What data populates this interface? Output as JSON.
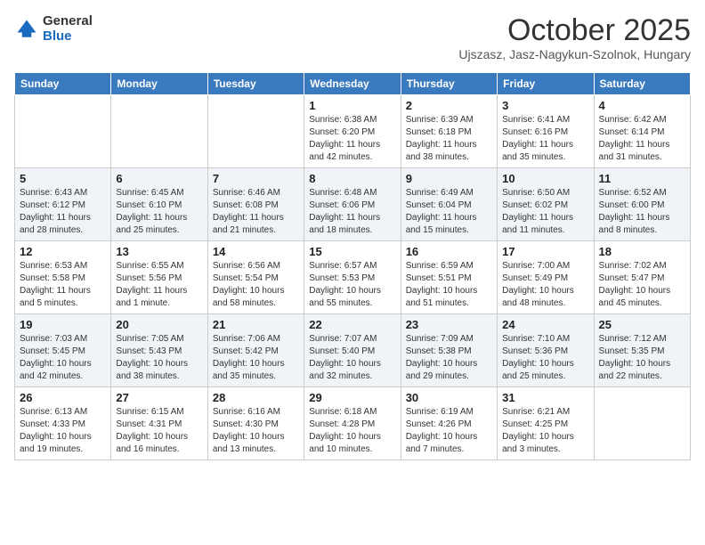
{
  "logo": {
    "general": "General",
    "blue": "Blue"
  },
  "header": {
    "title": "October 2025",
    "subtitle": "Ujszasz, Jasz-Nagykun-Szolnok, Hungary"
  },
  "weekdays": [
    "Sunday",
    "Monday",
    "Tuesday",
    "Wednesday",
    "Thursday",
    "Friday",
    "Saturday"
  ],
  "weeks": [
    [
      {
        "day": "",
        "sunrise": "",
        "sunset": "",
        "daylight": ""
      },
      {
        "day": "",
        "sunrise": "",
        "sunset": "",
        "daylight": ""
      },
      {
        "day": "",
        "sunrise": "",
        "sunset": "",
        "daylight": ""
      },
      {
        "day": "1",
        "sunrise": "Sunrise: 6:38 AM",
        "sunset": "Sunset: 6:20 PM",
        "daylight": "Daylight: 11 hours and 42 minutes."
      },
      {
        "day": "2",
        "sunrise": "Sunrise: 6:39 AM",
        "sunset": "Sunset: 6:18 PM",
        "daylight": "Daylight: 11 hours and 38 minutes."
      },
      {
        "day": "3",
        "sunrise": "Sunrise: 6:41 AM",
        "sunset": "Sunset: 6:16 PM",
        "daylight": "Daylight: 11 hours and 35 minutes."
      },
      {
        "day": "4",
        "sunrise": "Sunrise: 6:42 AM",
        "sunset": "Sunset: 6:14 PM",
        "daylight": "Daylight: 11 hours and 31 minutes."
      }
    ],
    [
      {
        "day": "5",
        "sunrise": "Sunrise: 6:43 AM",
        "sunset": "Sunset: 6:12 PM",
        "daylight": "Daylight: 11 hours and 28 minutes."
      },
      {
        "day": "6",
        "sunrise": "Sunrise: 6:45 AM",
        "sunset": "Sunset: 6:10 PM",
        "daylight": "Daylight: 11 hours and 25 minutes."
      },
      {
        "day": "7",
        "sunrise": "Sunrise: 6:46 AM",
        "sunset": "Sunset: 6:08 PM",
        "daylight": "Daylight: 11 hours and 21 minutes."
      },
      {
        "day": "8",
        "sunrise": "Sunrise: 6:48 AM",
        "sunset": "Sunset: 6:06 PM",
        "daylight": "Daylight: 11 hours and 18 minutes."
      },
      {
        "day": "9",
        "sunrise": "Sunrise: 6:49 AM",
        "sunset": "Sunset: 6:04 PM",
        "daylight": "Daylight: 11 hours and 15 minutes."
      },
      {
        "day": "10",
        "sunrise": "Sunrise: 6:50 AM",
        "sunset": "Sunset: 6:02 PM",
        "daylight": "Daylight: 11 hours and 11 minutes."
      },
      {
        "day": "11",
        "sunrise": "Sunrise: 6:52 AM",
        "sunset": "Sunset: 6:00 PM",
        "daylight": "Daylight: 11 hours and 8 minutes."
      }
    ],
    [
      {
        "day": "12",
        "sunrise": "Sunrise: 6:53 AM",
        "sunset": "Sunset: 5:58 PM",
        "daylight": "Daylight: 11 hours and 5 minutes."
      },
      {
        "day": "13",
        "sunrise": "Sunrise: 6:55 AM",
        "sunset": "Sunset: 5:56 PM",
        "daylight": "Daylight: 11 hours and 1 minute."
      },
      {
        "day": "14",
        "sunrise": "Sunrise: 6:56 AM",
        "sunset": "Sunset: 5:54 PM",
        "daylight": "Daylight: 10 hours and 58 minutes."
      },
      {
        "day": "15",
        "sunrise": "Sunrise: 6:57 AM",
        "sunset": "Sunset: 5:53 PM",
        "daylight": "Daylight: 10 hours and 55 minutes."
      },
      {
        "day": "16",
        "sunrise": "Sunrise: 6:59 AM",
        "sunset": "Sunset: 5:51 PM",
        "daylight": "Daylight: 10 hours and 51 minutes."
      },
      {
        "day": "17",
        "sunrise": "Sunrise: 7:00 AM",
        "sunset": "Sunset: 5:49 PM",
        "daylight": "Daylight: 10 hours and 48 minutes."
      },
      {
        "day": "18",
        "sunrise": "Sunrise: 7:02 AM",
        "sunset": "Sunset: 5:47 PM",
        "daylight": "Daylight: 10 hours and 45 minutes."
      }
    ],
    [
      {
        "day": "19",
        "sunrise": "Sunrise: 7:03 AM",
        "sunset": "Sunset: 5:45 PM",
        "daylight": "Daylight: 10 hours and 42 minutes."
      },
      {
        "day": "20",
        "sunrise": "Sunrise: 7:05 AM",
        "sunset": "Sunset: 5:43 PM",
        "daylight": "Daylight: 10 hours and 38 minutes."
      },
      {
        "day": "21",
        "sunrise": "Sunrise: 7:06 AM",
        "sunset": "Sunset: 5:42 PM",
        "daylight": "Daylight: 10 hours and 35 minutes."
      },
      {
        "day": "22",
        "sunrise": "Sunrise: 7:07 AM",
        "sunset": "Sunset: 5:40 PM",
        "daylight": "Daylight: 10 hours and 32 minutes."
      },
      {
        "day": "23",
        "sunrise": "Sunrise: 7:09 AM",
        "sunset": "Sunset: 5:38 PM",
        "daylight": "Daylight: 10 hours and 29 minutes."
      },
      {
        "day": "24",
        "sunrise": "Sunrise: 7:10 AM",
        "sunset": "Sunset: 5:36 PM",
        "daylight": "Daylight: 10 hours and 25 minutes."
      },
      {
        "day": "25",
        "sunrise": "Sunrise: 7:12 AM",
        "sunset": "Sunset: 5:35 PM",
        "daylight": "Daylight: 10 hours and 22 minutes."
      }
    ],
    [
      {
        "day": "26",
        "sunrise": "Sunrise: 6:13 AM",
        "sunset": "Sunset: 4:33 PM",
        "daylight": "Daylight: 10 hours and 19 minutes."
      },
      {
        "day": "27",
        "sunrise": "Sunrise: 6:15 AM",
        "sunset": "Sunset: 4:31 PM",
        "daylight": "Daylight: 10 hours and 16 minutes."
      },
      {
        "day": "28",
        "sunrise": "Sunrise: 6:16 AM",
        "sunset": "Sunset: 4:30 PM",
        "daylight": "Daylight: 10 hours and 13 minutes."
      },
      {
        "day": "29",
        "sunrise": "Sunrise: 6:18 AM",
        "sunset": "Sunset: 4:28 PM",
        "daylight": "Daylight: 10 hours and 10 minutes."
      },
      {
        "day": "30",
        "sunrise": "Sunrise: 6:19 AM",
        "sunset": "Sunset: 4:26 PM",
        "daylight": "Daylight: 10 hours and 7 minutes."
      },
      {
        "day": "31",
        "sunrise": "Sunrise: 6:21 AM",
        "sunset": "Sunset: 4:25 PM",
        "daylight": "Daylight: 10 hours and 3 minutes."
      },
      {
        "day": "",
        "sunrise": "",
        "sunset": "",
        "daylight": ""
      }
    ]
  ]
}
